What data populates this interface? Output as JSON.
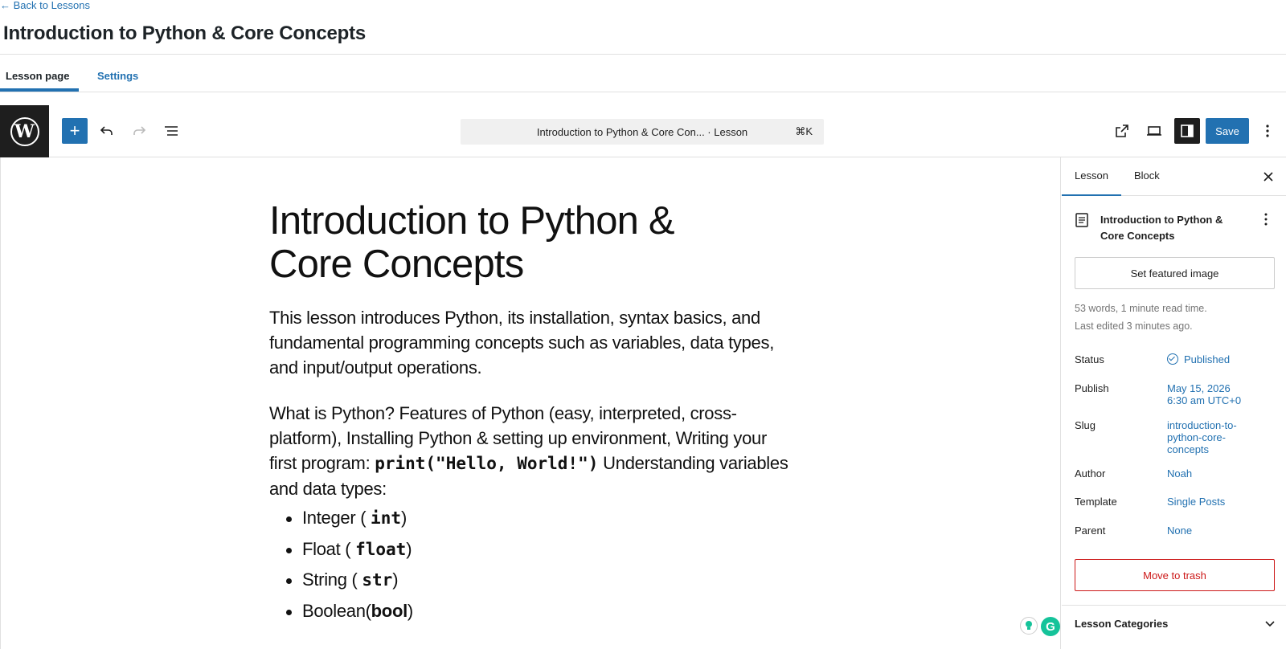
{
  "header": {
    "back_link": "← Back to Lessons",
    "page_title": "Introduction to Python & Core Concepts"
  },
  "tabs": [
    {
      "label": "Lesson page",
      "active": true
    },
    {
      "label": "Settings",
      "active": false
    }
  ],
  "toolbar": {
    "logo": "W",
    "add_label": "+",
    "command_bar_text": "Introduction to Python & Core Con... · Lesson",
    "command_shortcut": "⌘K",
    "save_label": "Save",
    "accent_color": "#2271b1"
  },
  "content": {
    "title": "Introduction to Python & Core Concepts",
    "paragraph1": "This lesson introduces Python, its installation, syntax basics, and fundamental programming concepts such as variables, data types, and input/output operations.",
    "paragraph2_before": "What is Python? Features of Python (easy, interpreted, cross-platform), Installing Python & setting up environment, Writing your first program: ",
    "paragraph2_code": "print(\"Hello, World!\")",
    "paragraph2_after": " Understanding variables and data types:",
    "list": [
      {
        "text": "Integer ( ",
        "code": "int",
        "end": ")"
      },
      {
        "text": "Float ( ",
        "code": "float",
        "end": ")"
      },
      {
        "text": "String ( ",
        "code": "str",
        "end": ")"
      },
      {
        "text": "Boolean(",
        "code": "bool",
        "end": ")"
      }
    ]
  },
  "sidebar": {
    "tabs": [
      "Lesson",
      "Block"
    ],
    "doc_title": "Introduction to Python & Core Concepts",
    "featured_image_button": "Set featured image",
    "word_count": "53 words, 1 minute read time.",
    "last_edited": "Last edited 3 minutes ago.",
    "rows": {
      "status": {
        "label": "Status",
        "value": "Published"
      },
      "publish": {
        "label": "Publish",
        "value_line1": "May 15, 2026",
        "value_line2": "6:30 am UTC+0"
      },
      "slug": {
        "label": "Slug",
        "value_line1": "introduction-to-",
        "value_line2": "python-core-",
        "value_line3": "concepts"
      },
      "author": {
        "label": "Author",
        "value": "Noah"
      },
      "template": {
        "label": "Template",
        "value": "Single Posts"
      },
      "parent": {
        "label": "Parent",
        "value": "None"
      }
    },
    "trash_button": "Move to trash",
    "categories_label": "Lesson Categories",
    "danger_color": "#cc1818"
  }
}
